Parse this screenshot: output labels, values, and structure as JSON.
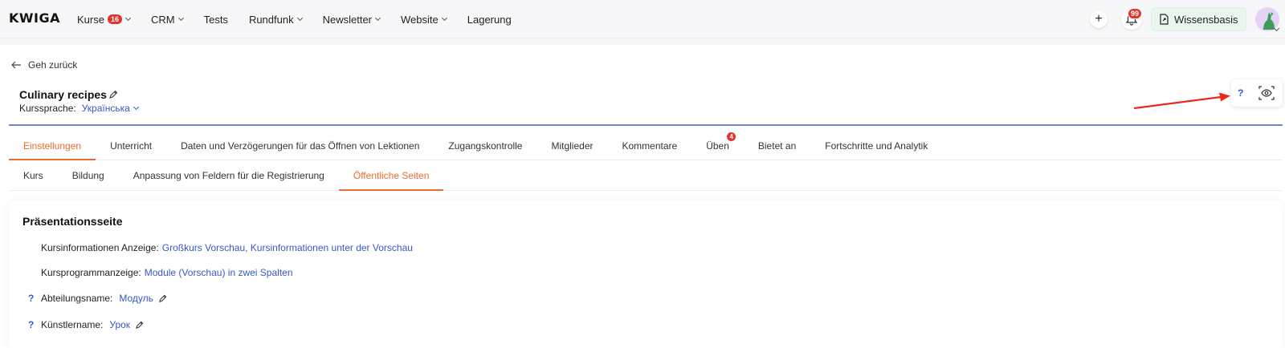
{
  "brand": {
    "logo": "KWIGA"
  },
  "nav": {
    "items": [
      {
        "label": "Kurse",
        "badge": "16",
        "dropdown": true
      },
      {
        "label": "CRM",
        "dropdown": true
      },
      {
        "label": "Tests",
        "dropdown": false
      },
      {
        "label": "Rundfunk",
        "dropdown": true
      },
      {
        "label": "Newsletter",
        "dropdown": true
      },
      {
        "label": "Website",
        "dropdown": true
      },
      {
        "label": "Lagerung",
        "dropdown": false
      }
    ],
    "add_icon": "plus-icon",
    "notifications_badge": "99",
    "knowledge_base_label": "Wissensbasis"
  },
  "page": {
    "back_label": "Geh zurück",
    "course_title": "Culinary recipes",
    "language_label": "Kurssprache:",
    "language_value": "Українська",
    "help_mark": "?"
  },
  "tabs": [
    {
      "label": "Einstellungen",
      "active": true
    },
    {
      "label": "Unterricht"
    },
    {
      "label": "Daten und Verzögerungen für das Öffnen von Lektionen"
    },
    {
      "label": "Zugangskontrolle"
    },
    {
      "label": "Mitglieder"
    },
    {
      "label": "Kommentare"
    },
    {
      "label": "Üben",
      "badge": "4"
    },
    {
      "label": "Bietet an"
    },
    {
      "label": "Fortschritte und Analytik"
    }
  ],
  "subtabs": [
    {
      "label": "Kurs"
    },
    {
      "label": "Bildung"
    },
    {
      "label": "Anpassung von Feldern für die Registrierung"
    },
    {
      "label": "Öffentliche Seiten",
      "active": true
    }
  ],
  "section": {
    "title": "Präsentationsseite",
    "rows": [
      {
        "label": "Kursinformationen Anzeige:",
        "value": "Großkurs Vorschau, Kursinformationen unter der Vorschau"
      },
      {
        "label": "Kursprogrammanzeige:",
        "value": "Module (Vorschau) in zwei Spalten"
      },
      {
        "label": "Abteilungsname:",
        "value": "Модуль",
        "help": "?"
      },
      {
        "label": "Künstlername:",
        "value": "Урок",
        "help": "?"
      }
    ]
  },
  "colors": {
    "accent": "#ec6c2e",
    "link": "#3559c7",
    "badge": "#e2342d",
    "annotation_arrow": "#e8281f"
  }
}
